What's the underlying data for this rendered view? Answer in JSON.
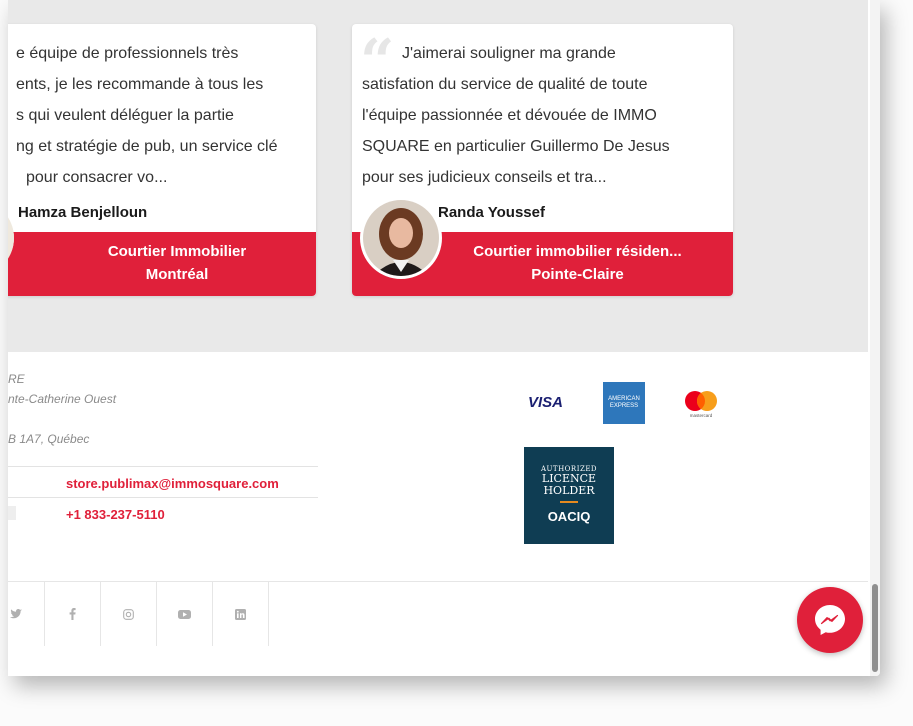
{
  "testimonials": [
    {
      "lines": [
        "e équipe de professionnels très",
        "ents, je les recommande à tous les",
        "s qui veulent déléguer la partie",
        "ng et stratégie de pub, un service clé",
        "pour consacrer vo..."
      ],
      "author": "Hamza Benjelloun",
      "role": "Courtier Immobilier",
      "city": "Montréal"
    },
    {
      "lines": [
        "J'aimerai souligner ma grande",
        "satisfation du service de qualité de toute",
        "l'équipe passionnée et dévouée de IMMO",
        "SQUARE en particulier Guillermo De Jesus",
        "pour ses judicieux conseils et tra..."
      ],
      "author": "Randa Youssef",
      "role": "Courtier immobilier résiden...",
      "city": "Pointe-Claire"
    }
  ],
  "footer": {
    "address": {
      "line1": "RE",
      "line2": "nte-Catherine Ouest",
      "line3": "B 1A7, Québec"
    },
    "email": "store.publimax@immosquare.com",
    "phone": "+1 833-237-5110",
    "payments": {
      "visa": "VISA",
      "amex": "AMERICAN EXPRESS",
      "mastercard": "mastercard"
    },
    "oaciq": {
      "authorized": "AUTHORIZED",
      "licence": "LICENCE",
      "holder": "HOLDER",
      "brand": "OACIQ"
    }
  },
  "social": [
    "twitter-icon",
    "facebook-icon",
    "instagram-icon",
    "youtube-icon",
    "linkedin-icon"
  ],
  "colors": {
    "accent": "#e0203a",
    "oaciq_bg": "#0f3d53",
    "amex_bg": "#2e77bb"
  }
}
